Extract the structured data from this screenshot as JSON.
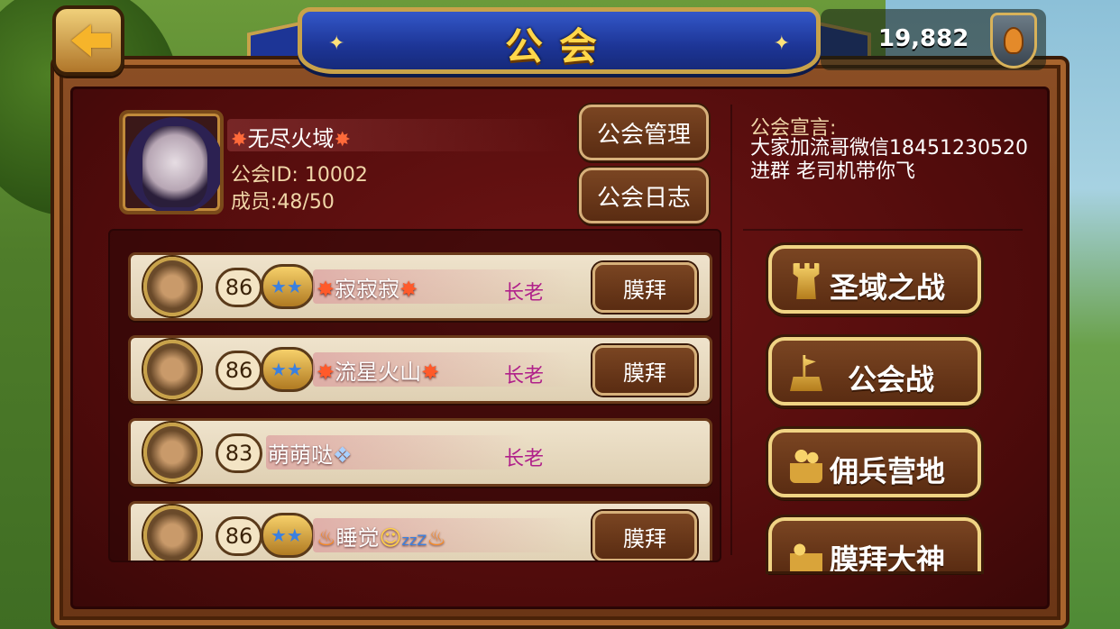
{
  "header": {
    "title": "公会",
    "back_label": "",
    "currency": "19,882",
    "currency_icon": "drumstick-shield-icon"
  },
  "guild": {
    "name": "无尽火域",
    "id_label": "公会ID:",
    "id_value": "10002",
    "members_label": "成员:",
    "members_value": "48/50",
    "manage_button": "公会管理",
    "log_button": "公会日志",
    "declaration_title": "公会宣言:",
    "declaration_text": "大家加流哥微信18451230520 进群 老司机带你飞"
  },
  "members": [
    {
      "level": "86",
      "name": "寂寂寂",
      "role": "长老",
      "action": "膜拜",
      "avatar": "pirate-captain-avatar"
    },
    {
      "level": "86",
      "name": "流星火山",
      "role": "长老",
      "action": "膜拜",
      "avatar": "dwarf-warrior-avatar"
    },
    {
      "level": "83",
      "name": "萌萌哒",
      "role": "长老",
      "action": "",
      "avatar": "elf-archer-avatar"
    },
    {
      "level": "86",
      "name": "睡觉",
      "role": "",
      "action": "膜拜",
      "avatar": "dark-mage-avatar"
    }
  ],
  "side_buttons": [
    {
      "label": "圣域之战",
      "icon": "tower-icon"
    },
    {
      "label": "公会战",
      "icon": "flag-icon"
    },
    {
      "label": "佣兵营地",
      "icon": "people-icon"
    },
    {
      "label": "膜拜大神",
      "icon": "worship-icon"
    }
  ],
  "colors": {
    "banner_blue": "#1d3596",
    "gold": "#ffd74a",
    "role_purple": "#b0208a",
    "panel_red": "#4e0b0b"
  }
}
